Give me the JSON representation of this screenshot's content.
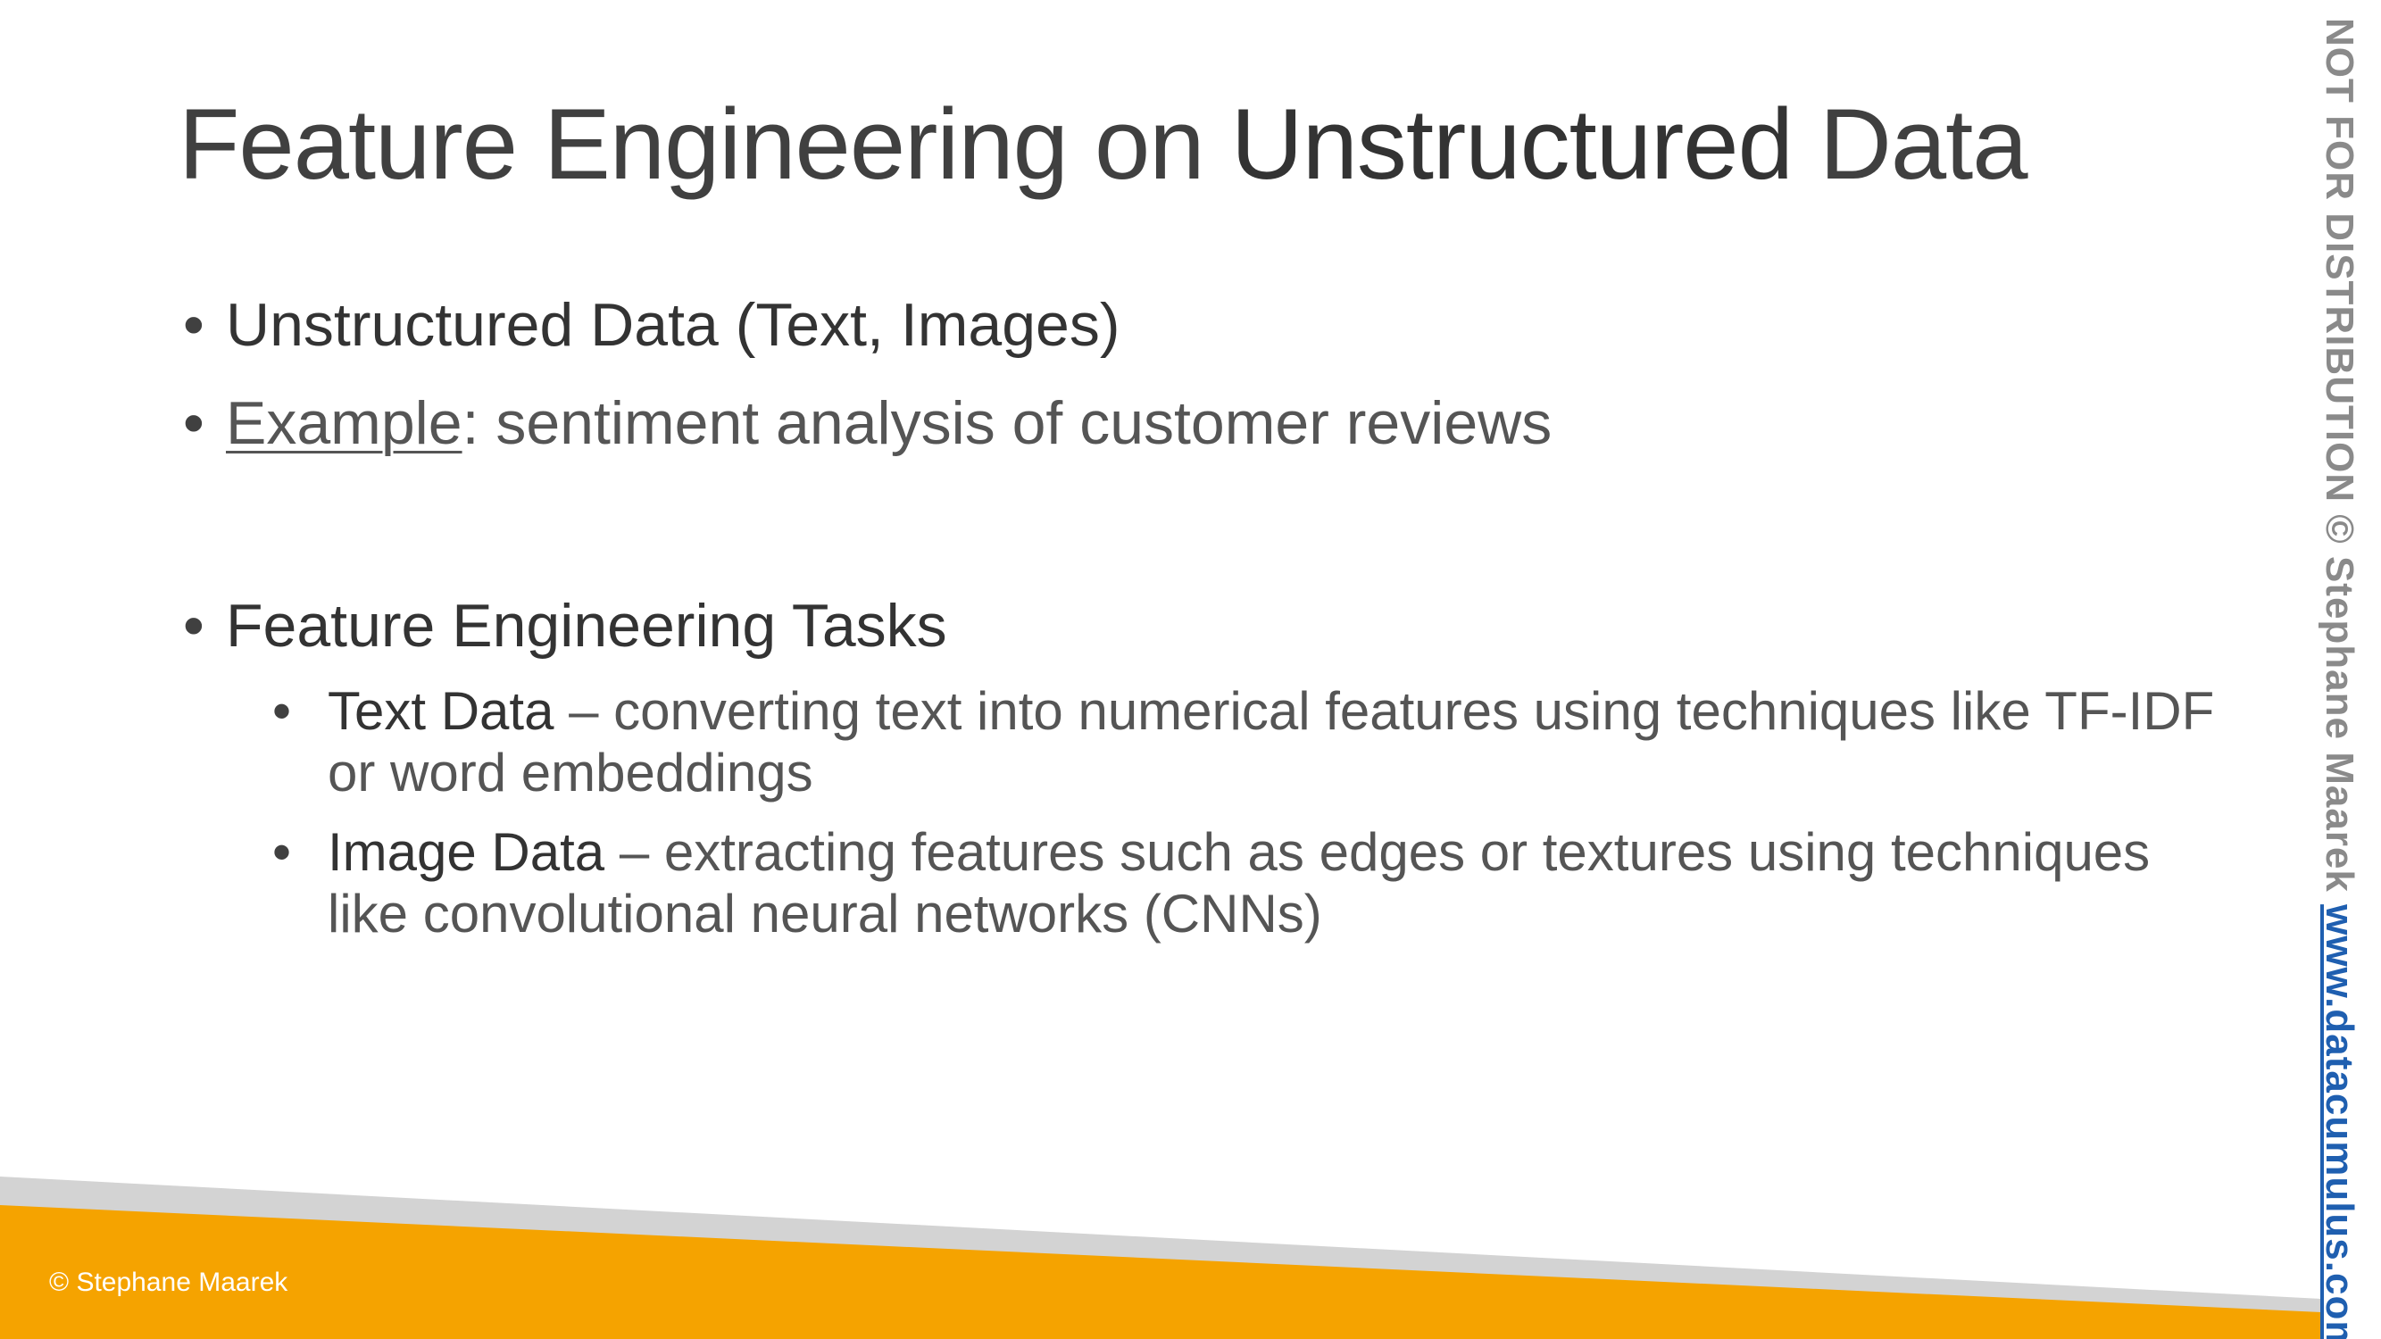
{
  "slide": {
    "title_part1": "Feature Engineering on ",
    "title_strong": "Unstructured",
    "title_part3": " Data",
    "bullets": [
      {
        "text": "Unstructured Data (Text, Images)"
      },
      {
        "label": "Example",
        "text": ": sentiment analysis of customer reviews"
      },
      {
        "text": "Feature Engineering Tasks"
      }
    ],
    "sub_bullets": [
      {
        "label": "Text Data",
        "line1": " – converting text into numerical features using techniques like TF-IDF",
        "line2": "or word embeddings"
      },
      {
        "label": "Image Data",
        "line1": " – extracting features such as edges or textures using techniques",
        "line2": "like convolutional neural networks (CNNs)"
      }
    ],
    "bullet_glyph": "•"
  },
  "footer": {
    "copyright": "© Stephane Maarek",
    "orange": "#F5A300",
    "gray": "#D3D3D3"
  },
  "watermark": {
    "notice": "NOT FOR DISTRIBUTION © Stephane Maarek ",
    "link": "www.datacumulus.com",
    "link_color": "#1F5FB0"
  }
}
